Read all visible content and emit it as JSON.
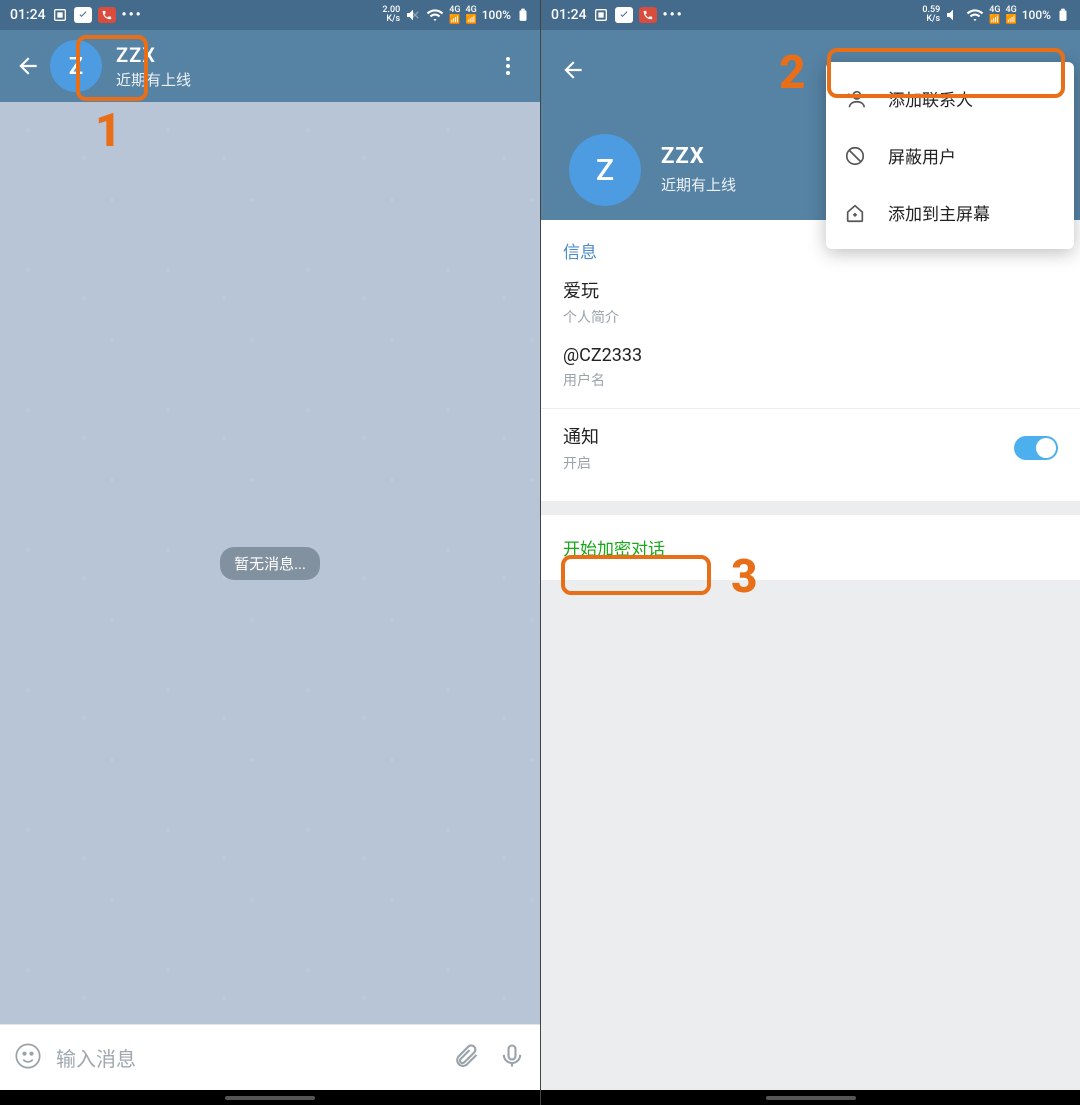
{
  "statusbar": {
    "time": "01:24",
    "speed1": "2.00",
    "speed1_unit": "K/s",
    "speed2": "0.59",
    "speed2_unit": "K/s",
    "net_label": "4G",
    "battery": "100%"
  },
  "chat": {
    "name": "ZZX",
    "avatar_letter": "Z",
    "status": "近期有上线",
    "empty_message": "暂无消息...",
    "input_placeholder": "输入消息"
  },
  "profile": {
    "name": "ZZX",
    "avatar_letter": "Z",
    "status": "近期有上线",
    "section_info_title": "信息",
    "bio_value": "爱玩",
    "bio_label": "个人简介",
    "username_value": "@CZ2333",
    "username_label": "用户名",
    "notif_title": "通知",
    "notif_state": "开启",
    "secret_chat_label": "开始加密对话"
  },
  "popup": {
    "add_contact": "添加联系人",
    "block_user": "屏蔽用户",
    "add_homescreen": "添加到主屏幕"
  },
  "annotations": {
    "n1": "1",
    "n2": "2",
    "n3": "3"
  }
}
